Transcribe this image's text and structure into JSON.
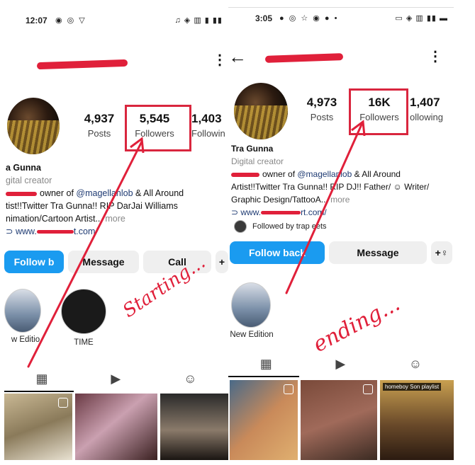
{
  "left": {
    "status": {
      "time": "12:07",
      "icons_left": "◉ ◎ ▽",
      "icons_right": "♫ ◈ ▥ ▮ ▮▮"
    },
    "kebab": "⋮",
    "stats": [
      {
        "num": "4,937",
        "label": "Posts"
      },
      {
        "num": "5,545",
        "label": "Followers"
      },
      {
        "num": "1,403",
        "label": "Followin"
      }
    ],
    "name": "a Gunna",
    "category": "gital creator",
    "bio_line1_suffix": "owner of ",
    "bio_mention": "@magellanlob",
    "bio_line1_end": " & All Around",
    "bio_line2": "tist!!Twitter Tra Gunna!! RIP DarJai Williams",
    "bio_line3": "nimation/Cartoon Artist...",
    "more": "more",
    "website": "www.",
    "website_end": "t.com/",
    "buttons": {
      "follow": "Follow b",
      "message": "Message",
      "call": "Call",
      "add": "+"
    },
    "highlights": [
      {
        "label": "w Editio"
      },
      {
        "label": "TIME"
      }
    ],
    "tab_icons": {
      "grid": "▦",
      "reels": "▶",
      "tagged": "☺"
    }
  },
  "right": {
    "status": {
      "time": "3:05",
      "icons_left": "● ◎ ☆ ◉ ● •",
      "icons_right": "▭ ◈ ▥ ▮▮ ▬"
    },
    "back": "←",
    "kebab": "⋮",
    "stats": [
      {
        "num": "4,973",
        "label": "Posts"
      },
      {
        "num": "16K",
        "label": "Followers"
      },
      {
        "num": "1,407",
        "label": "ollowing"
      }
    ],
    "name": "Tra Gunna",
    "category": "Digital creator",
    "bio_line1_suffix": "owner of ",
    "bio_mention": "@magellanlob",
    "bio_line1_end": " & All Around",
    "bio_line2": "Artist!!Twitter Tra Gunna!! RIP DJ!! Father/ ☺ Writer/",
    "bio_line3": "Graphic Design/TattooA...",
    "more": "more",
    "website": "www.",
    "website_end": "rt.com/",
    "followed_by": "Followed by trap eets",
    "buttons": {
      "follow": "Follow back",
      "message": "Message",
      "add": "+♀"
    },
    "highlights": [
      {
        "label": "New Edition"
      }
    ],
    "playlist_tag": "homeboy Son playlist",
    "tab_icons": {
      "grid": "▦",
      "reels": "▶",
      "tagged": "☺"
    }
  },
  "annotations": {
    "starting": "Starting...",
    "ending": "ending..."
  },
  "colors": {
    "accent_red": "#d9263e",
    "ig_blue": "#1a9bf0"
  }
}
